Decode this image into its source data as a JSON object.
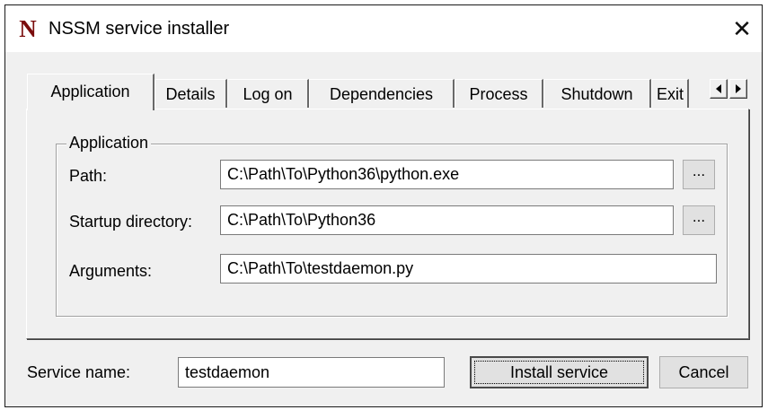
{
  "window": {
    "title": "NSSM service installer",
    "app_icon_letter": "N",
    "close_glyph": "✕"
  },
  "tabs": [
    {
      "label": "Application",
      "active": true
    },
    {
      "label": "Details"
    },
    {
      "label": "Log on"
    },
    {
      "label": "Dependencies"
    },
    {
      "label": "Process"
    },
    {
      "label": "Shutdown"
    },
    {
      "label": "Exit"
    }
  ],
  "tab_scroll": {
    "left_icon": "arrow-left-icon",
    "right_icon": "arrow-right-icon"
  },
  "application": {
    "group_label": "Application",
    "path_label": "Path:",
    "path_value": "C:\\Path\\To\\Python36\\python.exe",
    "startup_label": "Startup directory:",
    "startup_value": "C:\\Path\\To\\Python36",
    "arguments_label": "Arguments:",
    "arguments_value": "C:\\Path\\To\\testdaemon.py",
    "browse_label": "..."
  },
  "footer": {
    "service_name_label": "Service name:",
    "service_name_value": "testdaemon",
    "install_label": "Install service",
    "cancel_label": "Cancel"
  }
}
